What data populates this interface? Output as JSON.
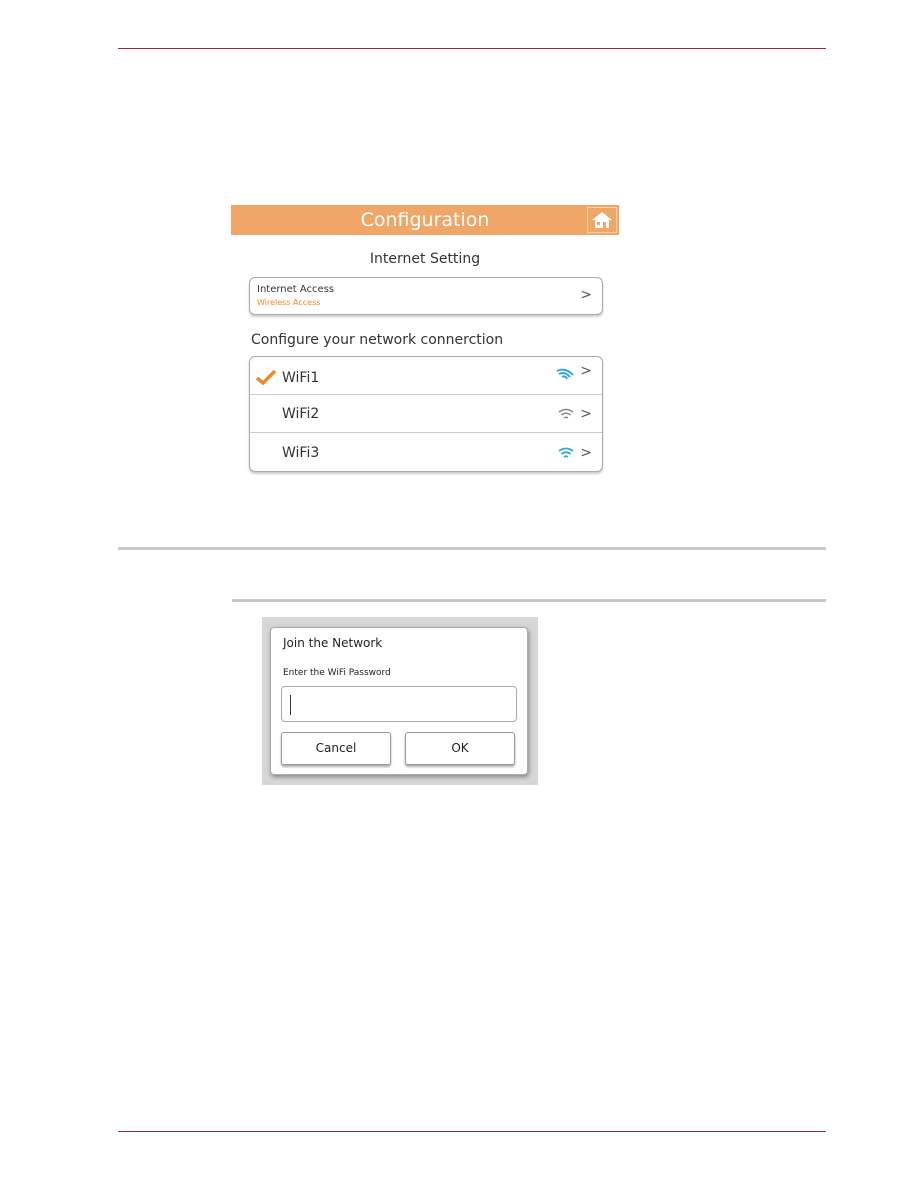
{
  "config_screen": {
    "title": "Configuration",
    "home_icon": "home-icon",
    "section_title": "Internet  Setting",
    "internet_access": {
      "label": "Internet Access",
      "value": "Wireless Access"
    },
    "network_heading": "Configure your network connerction",
    "networks": [
      {
        "name": "WiFi1",
        "selected": true,
        "signal_color": "#2aa8e0"
      },
      {
        "name": "WiFi2",
        "selected": false,
        "signal_color": "#888888"
      },
      {
        "name": "WiFi3",
        "selected": false,
        "signal_color": "#2aa8e0"
      }
    ],
    "colors": {
      "header": "#f0a667",
      "accent": "#f08a24"
    }
  },
  "join_dialog": {
    "title": "Join the Network",
    "prompt": "Enter the WiFi Password",
    "password_value": "",
    "cancel_label": "Cancel",
    "ok_label": "OK"
  }
}
